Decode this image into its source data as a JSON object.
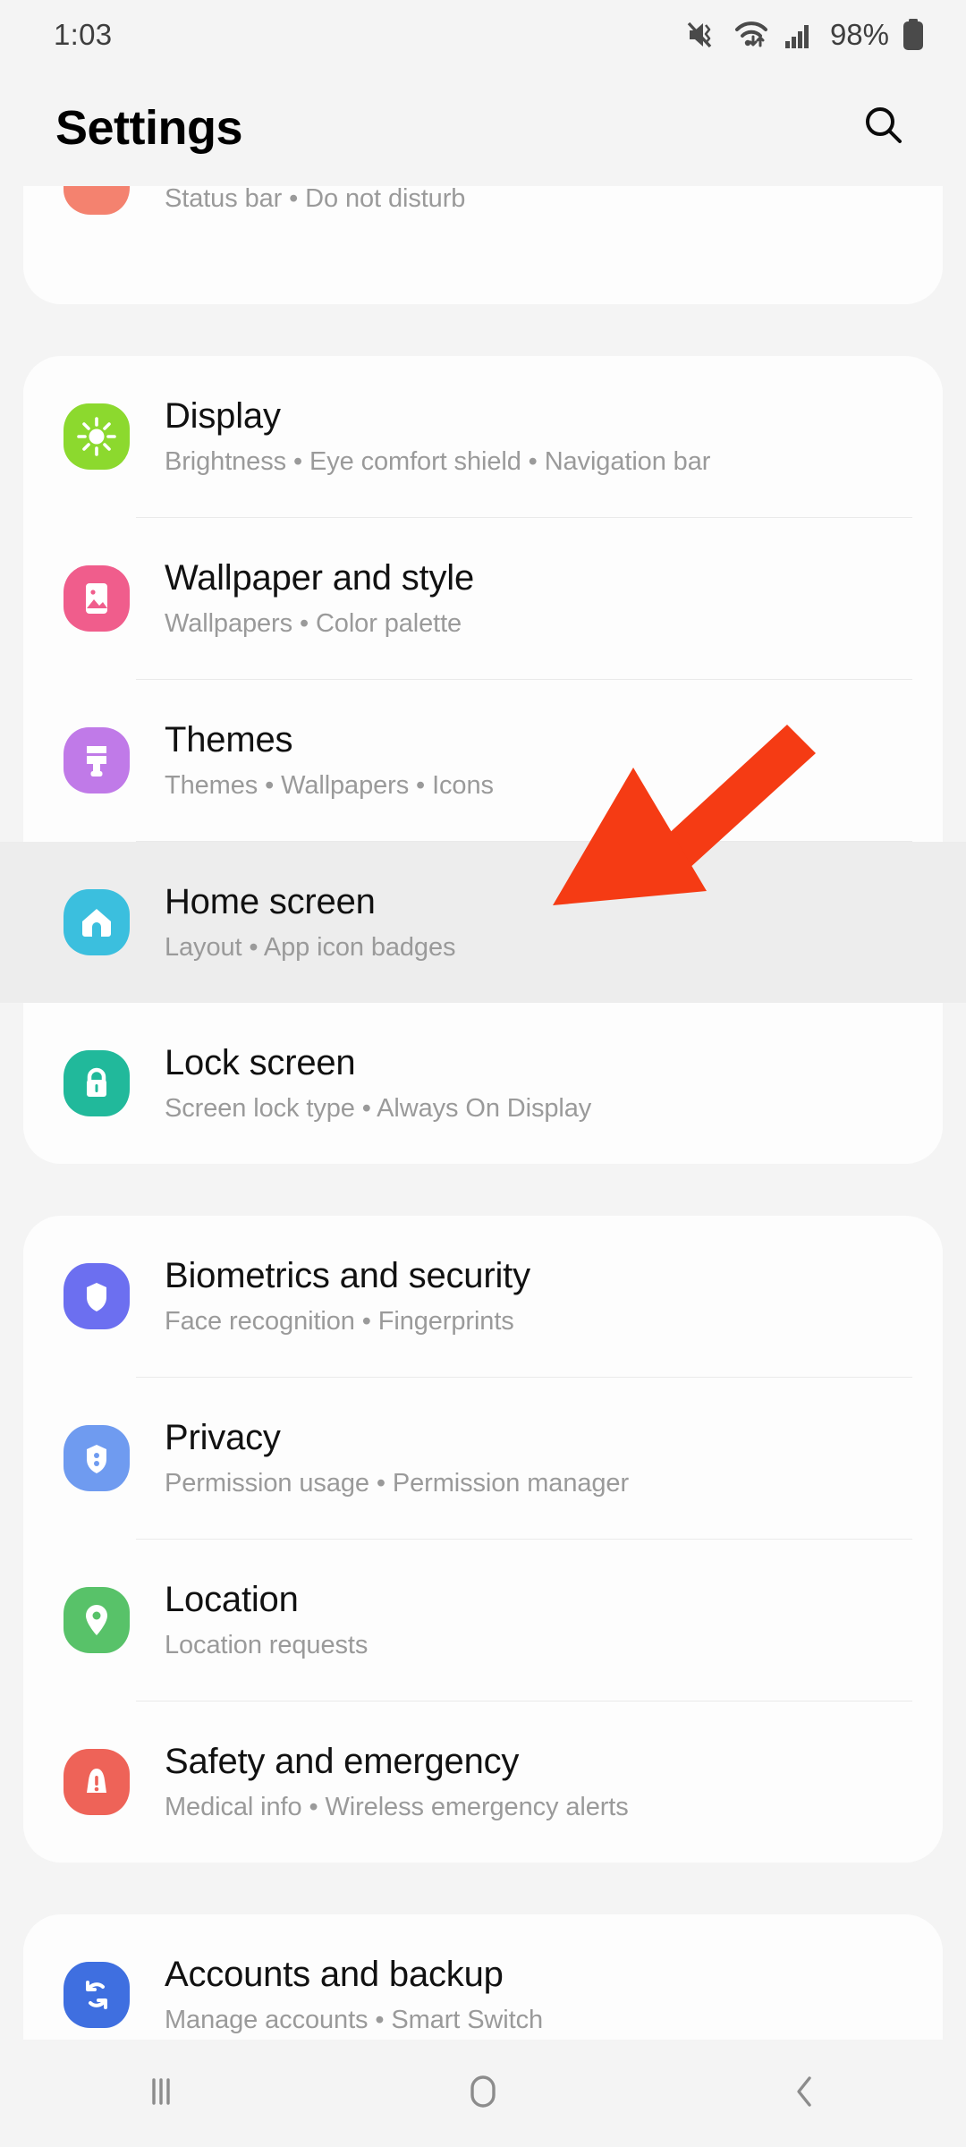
{
  "status_bar": {
    "time": "1:03",
    "battery_percent": "98%",
    "icons": [
      "mute-vibrate-icon",
      "wifi-icon",
      "signal-bars-icon",
      "battery-icon"
    ]
  },
  "header": {
    "title": "Settings",
    "search_label": "search-icon"
  },
  "theme": {
    "page_bg": "#f4f4f4",
    "card_bg": "#fdfdfd",
    "title_color": "#111111",
    "subtitle_color": "#9a9a9a",
    "highlight_bg": "#ededed",
    "arrow_color": "#f53b14"
  },
  "annotation": {
    "type": "arrow",
    "color": "#f53b14",
    "points_to": "Home screen",
    "direction": "down-left"
  },
  "sections": [
    {
      "id": "notifications-card",
      "partial": true,
      "items": [
        {
          "title": "",
          "subtitle": "Status bar  •  Do not disturb",
          "icon": "notifications-icon",
          "icon_color": "#f4826f",
          "highlight": false
        }
      ]
    },
    {
      "id": "display-card",
      "partial": false,
      "items": [
        {
          "title": "Display",
          "subtitle": "Brightness  •  Eye comfort shield  •  Navigation bar",
          "icon": "brightness-sun-icon",
          "icon_color": "#8cd92e",
          "highlight": false
        },
        {
          "title": "Wallpaper and style",
          "subtitle": "Wallpapers  •  Color palette",
          "icon": "wallpaper-image-icon",
          "icon_color": "#f05d8c",
          "highlight": false
        },
        {
          "title": "Themes",
          "subtitle": "Themes  •  Wallpapers  •  Icons",
          "icon": "paintbrush-icon",
          "icon_color": "#c07ae8",
          "highlight": false
        },
        {
          "title": "Home screen",
          "subtitle": "Layout  •  App icon badges",
          "icon": "home-house-icon",
          "icon_color": "#3bbfde",
          "highlight": true
        },
        {
          "title": "Lock screen",
          "subtitle": "Screen lock type  •  Always On Display",
          "icon": "lock-padlock-icon",
          "icon_color": "#21b99b",
          "highlight": false
        }
      ]
    },
    {
      "id": "security-card",
      "partial": false,
      "items": [
        {
          "title": "Biometrics and security",
          "subtitle": "Face recognition  •  Fingerprints",
          "icon": "shield-icon",
          "icon_color": "#6c6ff0",
          "highlight": false
        },
        {
          "title": "Privacy",
          "subtitle": "Permission usage  •  Permission manager",
          "icon": "privacy-shield-icon",
          "icon_color": "#6f9bf0",
          "highlight": false
        },
        {
          "title": "Location",
          "subtitle": "Location requests",
          "icon": "location-pin-icon",
          "icon_color": "#58c269",
          "highlight": false
        },
        {
          "title": "Safety and emergency",
          "subtitle": "Medical info  •  Wireless emergency alerts",
          "icon": "emergency-alert-icon",
          "icon_color": "#ee6358",
          "highlight": false
        }
      ]
    },
    {
      "id": "accounts-card",
      "partial": false,
      "items": [
        {
          "title": "Accounts and backup",
          "subtitle": "Manage accounts  •  Smart Switch",
          "icon": "sync-refresh-icon",
          "icon_color": "#3f6fe0",
          "highlight": false
        }
      ]
    }
  ],
  "navbar": {
    "buttons": [
      {
        "name": "recents-button",
        "icon": "recents-icon"
      },
      {
        "name": "home-button",
        "icon": "home-circle-icon"
      },
      {
        "name": "back-button",
        "icon": "back-chevron-icon"
      }
    ]
  }
}
